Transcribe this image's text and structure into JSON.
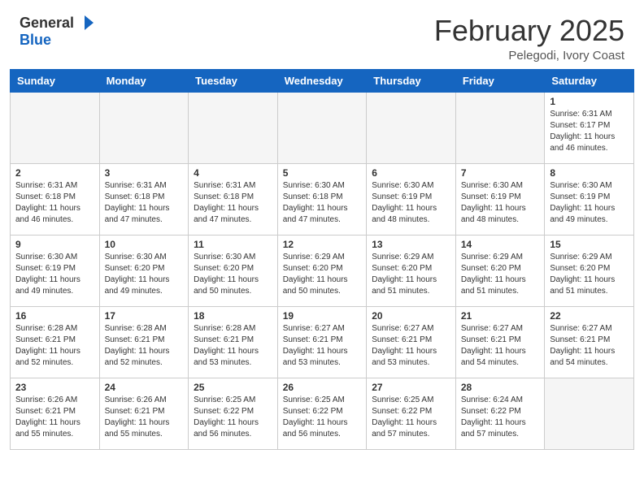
{
  "header": {
    "logo_general": "General",
    "logo_blue": "Blue",
    "month_title": "February 2025",
    "location": "Pelegodi, Ivory Coast"
  },
  "weekdays": [
    "Sunday",
    "Monday",
    "Tuesday",
    "Wednesday",
    "Thursday",
    "Friday",
    "Saturday"
  ],
  "weeks": [
    [
      {
        "day": "",
        "info": ""
      },
      {
        "day": "",
        "info": ""
      },
      {
        "day": "",
        "info": ""
      },
      {
        "day": "",
        "info": ""
      },
      {
        "day": "",
        "info": ""
      },
      {
        "day": "",
        "info": ""
      },
      {
        "day": "1",
        "info": "Sunrise: 6:31 AM\nSunset: 6:17 PM\nDaylight: 11 hours\nand 46 minutes."
      }
    ],
    [
      {
        "day": "2",
        "info": "Sunrise: 6:31 AM\nSunset: 6:18 PM\nDaylight: 11 hours\nand 46 minutes."
      },
      {
        "day": "3",
        "info": "Sunrise: 6:31 AM\nSunset: 6:18 PM\nDaylight: 11 hours\nand 47 minutes."
      },
      {
        "day": "4",
        "info": "Sunrise: 6:31 AM\nSunset: 6:18 PM\nDaylight: 11 hours\nand 47 minutes."
      },
      {
        "day": "5",
        "info": "Sunrise: 6:30 AM\nSunset: 6:18 PM\nDaylight: 11 hours\nand 47 minutes."
      },
      {
        "day": "6",
        "info": "Sunrise: 6:30 AM\nSunset: 6:19 PM\nDaylight: 11 hours\nand 48 minutes."
      },
      {
        "day": "7",
        "info": "Sunrise: 6:30 AM\nSunset: 6:19 PM\nDaylight: 11 hours\nand 48 minutes."
      },
      {
        "day": "8",
        "info": "Sunrise: 6:30 AM\nSunset: 6:19 PM\nDaylight: 11 hours\nand 49 minutes."
      }
    ],
    [
      {
        "day": "9",
        "info": "Sunrise: 6:30 AM\nSunset: 6:19 PM\nDaylight: 11 hours\nand 49 minutes."
      },
      {
        "day": "10",
        "info": "Sunrise: 6:30 AM\nSunset: 6:20 PM\nDaylight: 11 hours\nand 49 minutes."
      },
      {
        "day": "11",
        "info": "Sunrise: 6:30 AM\nSunset: 6:20 PM\nDaylight: 11 hours\nand 50 minutes."
      },
      {
        "day": "12",
        "info": "Sunrise: 6:29 AM\nSunset: 6:20 PM\nDaylight: 11 hours\nand 50 minutes."
      },
      {
        "day": "13",
        "info": "Sunrise: 6:29 AM\nSunset: 6:20 PM\nDaylight: 11 hours\nand 51 minutes."
      },
      {
        "day": "14",
        "info": "Sunrise: 6:29 AM\nSunset: 6:20 PM\nDaylight: 11 hours\nand 51 minutes."
      },
      {
        "day": "15",
        "info": "Sunrise: 6:29 AM\nSunset: 6:20 PM\nDaylight: 11 hours\nand 51 minutes."
      }
    ],
    [
      {
        "day": "16",
        "info": "Sunrise: 6:28 AM\nSunset: 6:21 PM\nDaylight: 11 hours\nand 52 minutes."
      },
      {
        "day": "17",
        "info": "Sunrise: 6:28 AM\nSunset: 6:21 PM\nDaylight: 11 hours\nand 52 minutes."
      },
      {
        "day": "18",
        "info": "Sunrise: 6:28 AM\nSunset: 6:21 PM\nDaylight: 11 hours\nand 53 minutes."
      },
      {
        "day": "19",
        "info": "Sunrise: 6:27 AM\nSunset: 6:21 PM\nDaylight: 11 hours\nand 53 minutes."
      },
      {
        "day": "20",
        "info": "Sunrise: 6:27 AM\nSunset: 6:21 PM\nDaylight: 11 hours\nand 53 minutes."
      },
      {
        "day": "21",
        "info": "Sunrise: 6:27 AM\nSunset: 6:21 PM\nDaylight: 11 hours\nand 54 minutes."
      },
      {
        "day": "22",
        "info": "Sunrise: 6:27 AM\nSunset: 6:21 PM\nDaylight: 11 hours\nand 54 minutes."
      }
    ],
    [
      {
        "day": "23",
        "info": "Sunrise: 6:26 AM\nSunset: 6:21 PM\nDaylight: 11 hours\nand 55 minutes."
      },
      {
        "day": "24",
        "info": "Sunrise: 6:26 AM\nSunset: 6:21 PM\nDaylight: 11 hours\nand 55 minutes."
      },
      {
        "day": "25",
        "info": "Sunrise: 6:25 AM\nSunset: 6:22 PM\nDaylight: 11 hours\nand 56 minutes."
      },
      {
        "day": "26",
        "info": "Sunrise: 6:25 AM\nSunset: 6:22 PM\nDaylight: 11 hours\nand 56 minutes."
      },
      {
        "day": "27",
        "info": "Sunrise: 6:25 AM\nSunset: 6:22 PM\nDaylight: 11 hours\nand 57 minutes."
      },
      {
        "day": "28",
        "info": "Sunrise: 6:24 AM\nSunset: 6:22 PM\nDaylight: 11 hours\nand 57 minutes."
      },
      {
        "day": "",
        "info": ""
      }
    ]
  ]
}
